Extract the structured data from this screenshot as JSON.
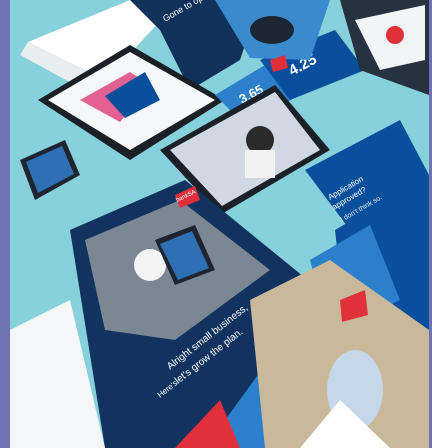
{
  "photo": {
    "background_color": "#86d1db",
    "frame_edge_color": "#6f73b0",
    "brand_blue": "#0a4f9c",
    "brand_dark": "#12325f",
    "accent_red": "#e0313b",
    "logo_text": "bankSA"
  },
  "texts": {
    "rate_left": "3.65",
    "rate_right": "4.25",
    "tablet_headline": "Gone to open quantum",
    "poster_headline_1": "Alright small business,",
    "poster_headline_2": "let's grow the plan.",
    "poster_headline_3": "Here's",
    "card_headline_1": "Application",
    "card_headline_2": "approved?",
    "card_headline_3": "I don't think so."
  }
}
